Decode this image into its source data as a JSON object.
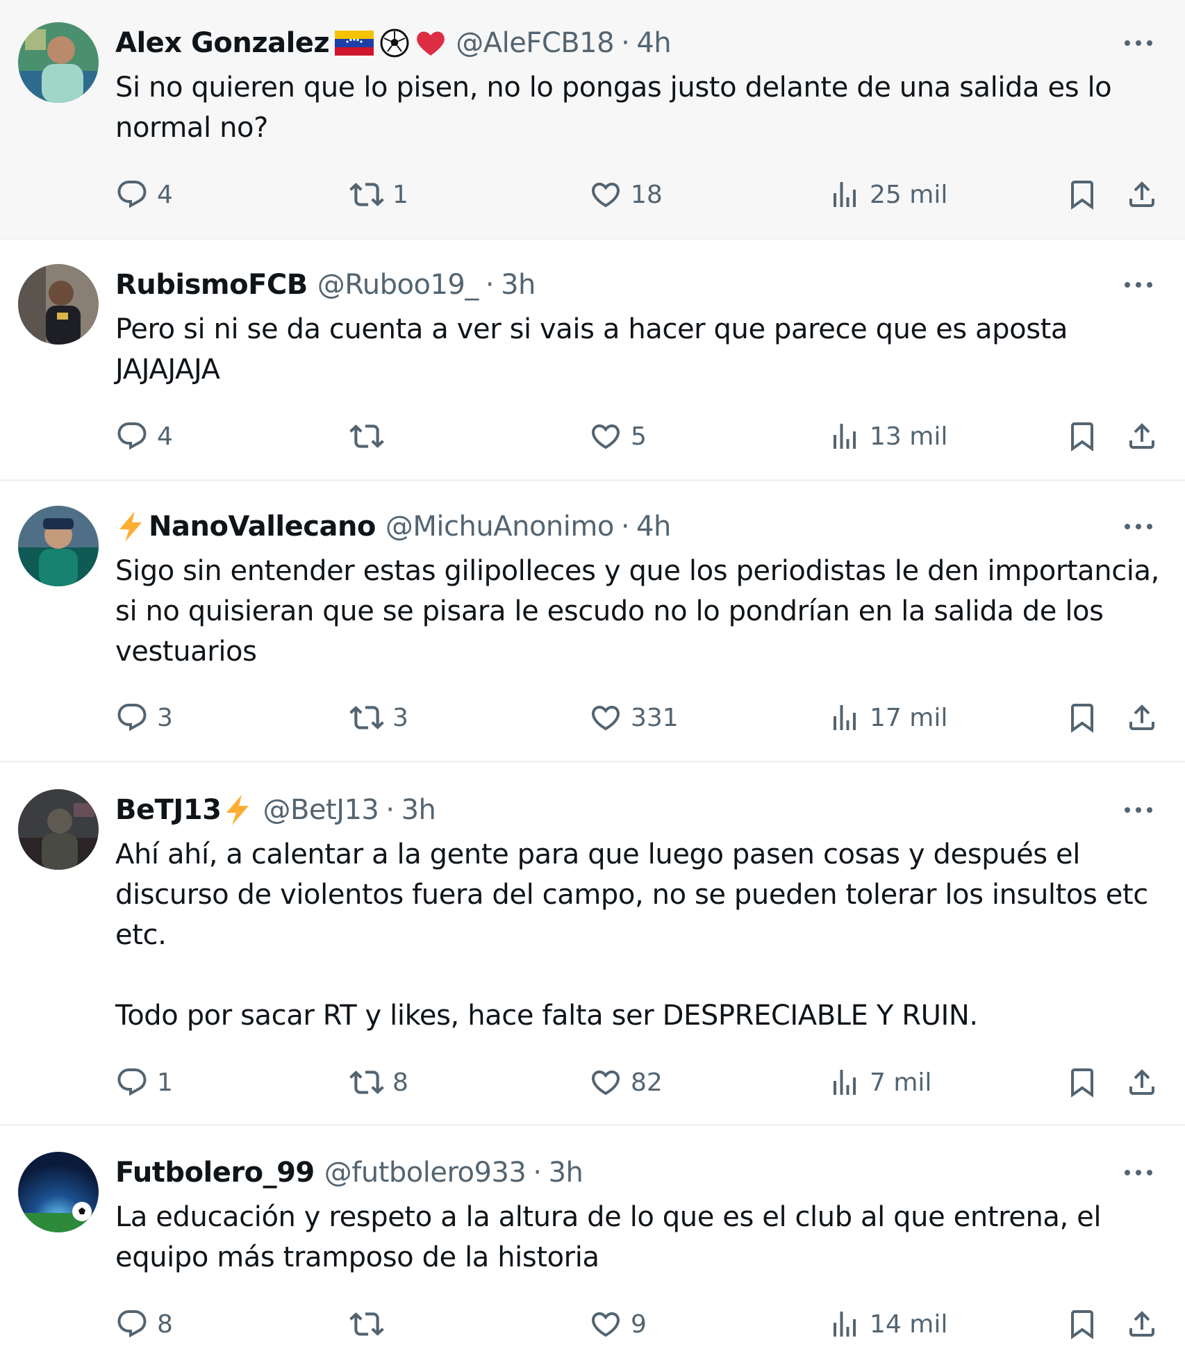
{
  "tweets": [
    {
      "name": "Alex Gonzalez",
      "prefix_emoji": [],
      "suffix_emoji": [
        "venezuela-flag",
        "soccer-ball",
        "red-heart"
      ],
      "handle": "@AleFCB18",
      "time": "4h",
      "text": "Si no quieren que lo pisen, no lo pongas justo delante de una salida es lo normal no?",
      "replies": "4",
      "retweets": "1",
      "likes": "18",
      "views": "25 mil",
      "highlighted": true
    },
    {
      "name": "RubismoFCB",
      "prefix_emoji": [],
      "suffix_emoji": [],
      "handle": "@Ruboo19_",
      "time": "3h",
      "text": "Pero si ni se da cuenta a ver si vais a hacer que parece que es aposta JAJAJAJA",
      "replies": "4",
      "retweets": "",
      "likes": "5",
      "views": "13 mil",
      "highlighted": false
    },
    {
      "name": "NanoVallecano",
      "prefix_emoji": [
        "lightning"
      ],
      "suffix_emoji": [],
      "handle": "@MichuAnonimo",
      "time": "4h",
      "text": "Sigo sin entender estas gilipolleces y que los periodistas le den importancia, si no quisieran que se pisara le escudo no lo pondrían en la salida de los vestuarios",
      "replies": "3",
      "retweets": "3",
      "likes": "331",
      "views": "17 mil",
      "highlighted": false
    },
    {
      "name": "BeTJ13",
      "prefix_emoji": [],
      "suffix_emoji": [
        "lightning"
      ],
      "handle": "@BetJ13",
      "time": "3h",
      "text": "Ahí ahí, a calentar a la gente para que luego pasen cosas y después el discurso de violentos fuera del campo, no se pueden tolerar los insultos etc etc.\n\nTodo por sacar RT y likes, hace falta ser DESPRECIABLE Y RUIN.",
      "replies": "1",
      "retweets": "8",
      "likes": "82",
      "views": "7 mil",
      "highlighted": false
    },
    {
      "name": "Futbolero_99",
      "prefix_emoji": [],
      "suffix_emoji": [],
      "handle": "@futbolero933",
      "time": "3h",
      "text": "La educación y respeto a la altura de lo que es el club al que entrena, el equipo más tramposo de la historia",
      "replies": "8",
      "retweets": "",
      "likes": "9",
      "views": "14 mil",
      "highlighted": false
    }
  ],
  "dot_separator": "·",
  "colors": {
    "text": "#0f1419",
    "secondary": "#536471",
    "divider": "#eff3f4",
    "highlight_bg": "#f7f7f7"
  }
}
